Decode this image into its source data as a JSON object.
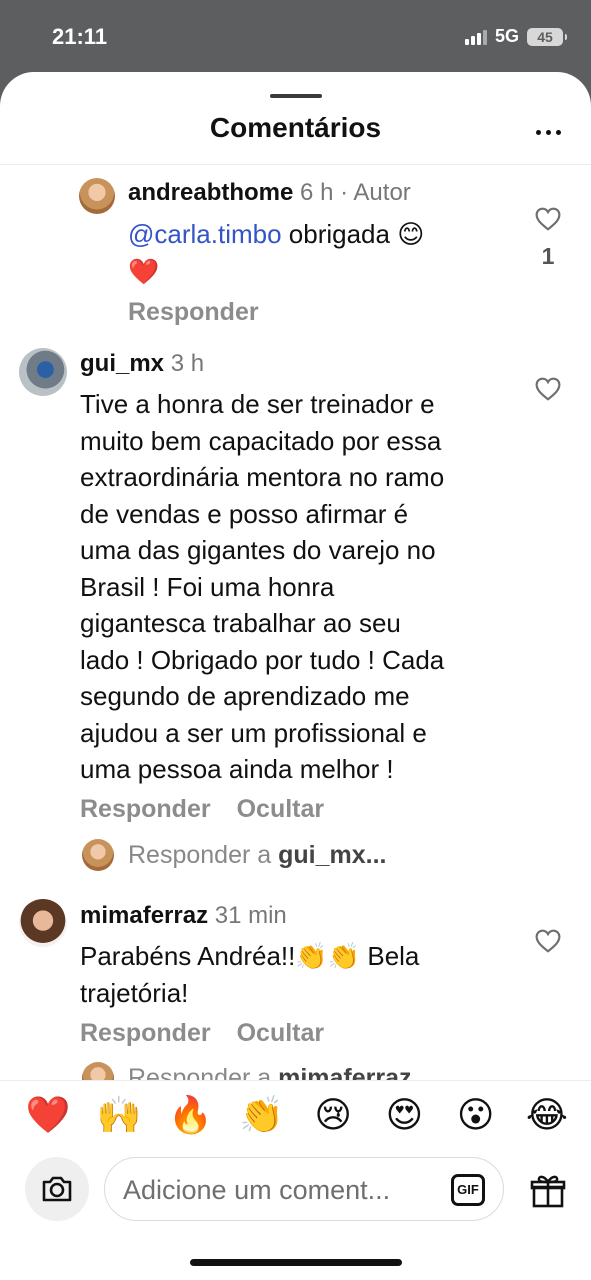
{
  "status_bar": {
    "time": "21:11",
    "network": "5G",
    "battery": "45"
  },
  "header": {
    "title": "Comentários"
  },
  "comments": [
    {
      "username": "andreabthome",
      "time": "6 h · Autor",
      "mention": "@carla.timbo",
      "text": " obrigada 😊",
      "text_line2": "❤️",
      "likes": "1",
      "reply_label": "Responder"
    },
    {
      "username": "gui_mx",
      "time": "3 h",
      "lines": [
        "Tive a honra de ser treinador e",
        "muito bem capacitado por essa",
        "extraordinária mentora no ramo",
        "de vendas e posso afirmar é",
        "uma das gigantes do varejo no",
        "Brasil ! Foi uma honra",
        "gigantesca trabalhar ao seu",
        "lado ! Obrigado por tudo ! Cada",
        "segundo de aprendizado me",
        "ajudou a ser um profissional e",
        "uma pessoa ainda melhor !"
      ],
      "reply_label": "Responder",
      "hide_label": "Ocultar",
      "reply_prompt": "Responder a ",
      "reply_prompt_user": "gui_mx..."
    },
    {
      "username": "mimaferraz",
      "time": "31 min",
      "line1": "Parabéns Andréa!!👏👏 Bela",
      "line2": "trajetória!",
      "reply_label": "Responder",
      "hide_label": "Ocultar",
      "reply_prompt": "Responder a ",
      "reply_prompt_user": "mimaferraz"
    }
  ],
  "emoji_bar": [
    "❤️",
    "🙌",
    "🔥",
    "👏",
    "😢",
    "😍",
    "😮",
    "😂"
  ],
  "composer": {
    "placeholder": "Adicione um coment...",
    "gif_label": "GIF"
  },
  "colors": {
    "mention": "#3555c7",
    "secondary_text": "#8c8c8c",
    "status_bar_bg": "#5d5e60"
  }
}
